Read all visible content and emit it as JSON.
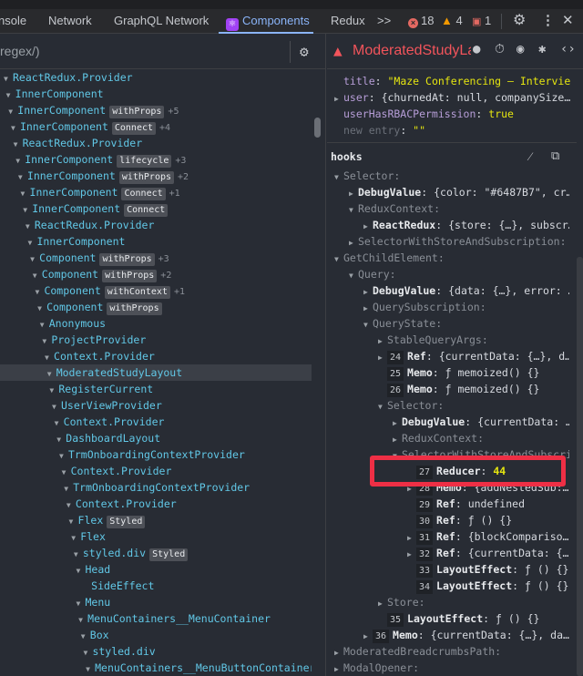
{
  "tabs": {
    "items": [
      "nsole",
      "Network",
      "GraphQL Network",
      "Components",
      "Redux"
    ],
    "active": "Components",
    "more": ">>",
    "errors": "18",
    "warnings": "4",
    "issues": "1"
  },
  "search": {
    "placeholder": "regex/)"
  },
  "tree": [
    {
      "name": "ReactRedux.Provider",
      "d": 0
    },
    {
      "name": "InnerComponent",
      "d": 1
    },
    {
      "name": "InnerComponent",
      "badge": "withProps",
      "plus": "+5",
      "d": 2
    },
    {
      "name": "InnerComponent",
      "badge": "Connect",
      "plus": "+4",
      "d": 3
    },
    {
      "name": "ReactRedux.Provider",
      "d": 4
    },
    {
      "name": "InnerComponent",
      "badge": "lifecycle",
      "plus": "+3",
      "d": 5
    },
    {
      "name": "InnerComponent",
      "badge": "withProps",
      "plus": "+2",
      "d": 6
    },
    {
      "name": "InnerComponent",
      "badge": "Connect",
      "plus": "+1",
      "d": 7
    },
    {
      "name": "InnerComponent",
      "badge": "Connect",
      "d": 8
    },
    {
      "name": "ReactRedux.Provider",
      "d": 9
    },
    {
      "name": "InnerComponent",
      "d": 10
    },
    {
      "name": "Component",
      "badge": "withProps",
      "plus": "+3",
      "d": 11
    },
    {
      "name": "Component",
      "badge": "withProps",
      "plus": "+2",
      "d": 12
    },
    {
      "name": "Component",
      "badge": "withContext",
      "plus": "+1",
      "d": 13
    },
    {
      "name": "Component",
      "badge": "withProps",
      "d": 14
    },
    {
      "name": "Anonymous",
      "d": 15
    },
    {
      "name": "ProjectProvider",
      "d": 16
    },
    {
      "name": "Context.Provider",
      "d": 17
    },
    {
      "name": "ModeratedStudyLayout",
      "d": 18,
      "selected": true
    },
    {
      "name": "RegisterCurrent",
      "d": 19
    },
    {
      "name": "UserViewProvider",
      "d": 20
    },
    {
      "name": "Context.Provider",
      "d": 21
    },
    {
      "name": "DashboardLayout",
      "d": 22
    },
    {
      "name": "TrmOnboardingContextProvider",
      "d": 23
    },
    {
      "name": "Context.Provider",
      "d": 24
    },
    {
      "name": "TrmOnboardingContextProvider",
      "d": 25
    },
    {
      "name": "Context.Provider",
      "d": 26
    },
    {
      "name": "Flex",
      "badge": "Styled",
      "d": 27
    },
    {
      "name": "Flex",
      "d": 28
    },
    {
      "name": "styled.div",
      "badge": "Styled",
      "d": 29
    },
    {
      "name": "Head",
      "d": 30
    },
    {
      "name": "SideEffect",
      "d": 31,
      "leaf": true
    },
    {
      "name": "Menu",
      "d": 30
    },
    {
      "name": "MenuContainers__MenuContainer",
      "d": 31
    },
    {
      "name": "Box",
      "d": 32
    },
    {
      "name": "styled.div",
      "d": 33
    },
    {
      "name": "MenuContainers__MenuButtonContainer",
      "d": 34
    }
  ],
  "selected": {
    "title": "ModeratedStudyLa"
  },
  "props": [
    {
      "key": "title",
      "value": "\"Maze Conferencing – Intervie"
    },
    {
      "key": "user",
      "value": "{churnedAt: null, companySize…",
      "expand": true
    },
    {
      "key": "userHasRBACPermission",
      "value": "true"
    },
    {
      "key": "new entry",
      "value": "\"\""
    }
  ],
  "hooks_label": "hooks",
  "hooks": [
    {
      "k": "Selector",
      "d": 0,
      "a": "open",
      "dim": true
    },
    {
      "k": "DebugValue",
      "v": "{color: \"#6487B7\", cr…",
      "d": 1,
      "a": "closed"
    },
    {
      "k": "ReduxContext",
      "d": 1,
      "a": "open",
      "dim": true
    },
    {
      "k": "ReactRedux",
      "v": "{store: {…}, subscr…",
      "d": 2,
      "a": "closed"
    },
    {
      "k": "SelectorWithStoreAndSubscription",
      "d": 1,
      "a": "closed",
      "dim": true
    },
    {
      "k": "GetChildElement",
      "d": 0,
      "a": "open",
      "dim": true
    },
    {
      "k": "Query",
      "d": 1,
      "a": "open",
      "dim": true
    },
    {
      "k": "DebugValue",
      "v": "{data: {…}, error: …",
      "d": 2,
      "a": "closed"
    },
    {
      "k": "QuerySubscription",
      "d": 2,
      "a": "closed",
      "dim": true
    },
    {
      "k": "QueryState",
      "d": 2,
      "a": "open",
      "dim": true
    },
    {
      "k": "StableQueryArgs",
      "d": 3,
      "a": "closed",
      "dim": true
    },
    {
      "id": "24",
      "k": "Ref",
      "v": "{currentData: {…}, d…",
      "d": 3,
      "a": "closed"
    },
    {
      "id": "25",
      "k": "Memo",
      "v": "ƒ memoized() {}",
      "d": 3
    },
    {
      "id": "26",
      "k": "Memo",
      "v": "ƒ memoized() {}",
      "d": 3
    },
    {
      "k": "Selector",
      "d": 3,
      "a": "open",
      "dim": true
    },
    {
      "k": "DebugValue",
      "v": "{currentData: …",
      "d": 4,
      "a": "closed"
    },
    {
      "k": "ReduxContext",
      "d": 4,
      "a": "closed",
      "dim": true
    },
    {
      "k": "SelectorWithStoreAndSubscrip",
      "d": 4,
      "a": "open",
      "dim": true
    },
    {
      "id": "27",
      "k": "Reducer",
      "v": "44",
      "d": 5,
      "yellow": true
    },
    {
      "id": "28",
      "k": "Memo",
      "v": "{addNestedSub:…",
      "d": 5,
      "a": "closed"
    },
    {
      "id": "29",
      "k": "Ref",
      "v": "undefined",
      "d": 5
    },
    {
      "id": "30",
      "k": "Ref",
      "v": "ƒ () {}",
      "d": 5
    },
    {
      "id": "31",
      "k": "Ref",
      "v": "{blockCompariso…",
      "d": 5,
      "a": "closed"
    },
    {
      "id": "32",
      "k": "Ref",
      "v": "{currentData: {…",
      "d": 5,
      "a": "closed"
    },
    {
      "id": "33",
      "k": "LayoutEffect",
      "v": "ƒ () {}",
      "d": 5
    },
    {
      "id": "34",
      "k": "LayoutEffect",
      "v": "ƒ () {}",
      "d": 5
    },
    {
      "k": "Store",
      "d": 3,
      "a": "closed",
      "dim": true
    },
    {
      "id": "35",
      "k": "LayoutEffect",
      "v": "ƒ () {}",
      "d": 3
    },
    {
      "id": "36",
      "k": "Memo",
      "v": "{currentData: {…}, da…",
      "d": 2,
      "a": "closed"
    },
    {
      "k": "ModeratedBreadcrumbsPath",
      "d": 0,
      "a": "closed",
      "dim": true
    },
    {
      "k": "ModalOpener",
      "d": 0,
      "a": "closed",
      "dim": true
    }
  ]
}
